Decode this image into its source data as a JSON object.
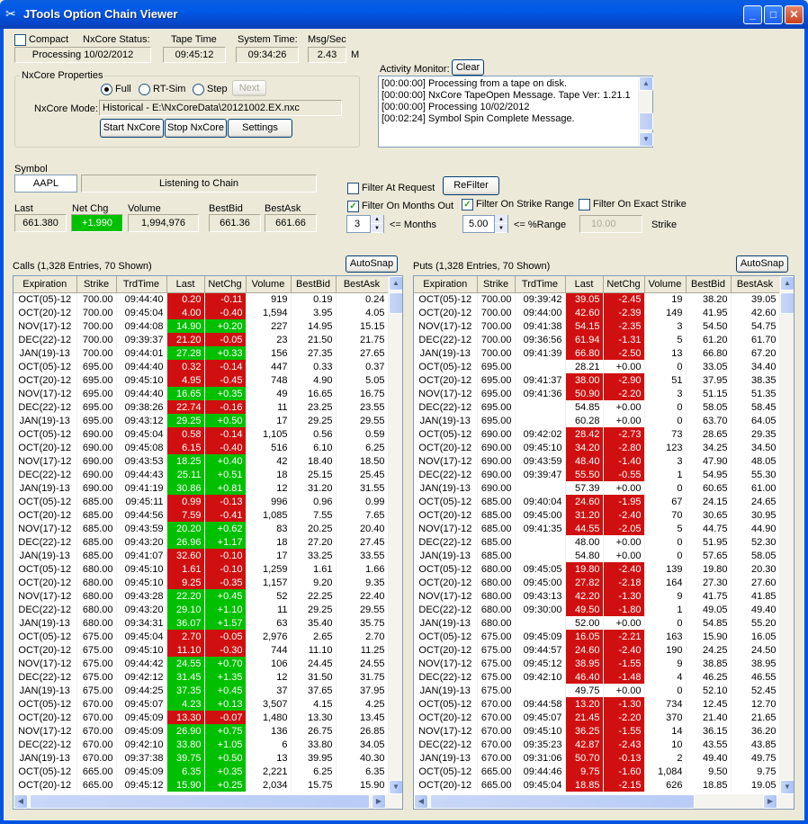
{
  "window": {
    "title": "JTools Option Chain Viewer"
  },
  "status": {
    "compact_label": "Compact",
    "nxcore_status_label": "NxCore Status:",
    "nxcore_status_value": "Processing 10/02/2012",
    "tape_time_label": "Tape Time",
    "tape_time_value": "09:45:12",
    "system_time_label": "System Time:",
    "system_time_value": "09:34:26",
    "msg_sec_label": "Msg/Sec",
    "msg_sec_value": "2.43",
    "msg_sec_unit": "M"
  },
  "props": {
    "group_label": "NxCore Properties",
    "mode_full": "Full",
    "mode_rtsim": "RT-Sim",
    "mode_step": "Step",
    "next_label": "Next",
    "mode_label": "NxCore Mode:",
    "mode_value": "Historical - E:\\NxCoreData\\20121002.EX.nxc",
    "start_label": "Start NxCore",
    "stop_label": "Stop NxCore",
    "settings_label": "Settings"
  },
  "activity": {
    "label": "Activity Monitor:",
    "clear_label": "Clear",
    "lines": [
      "[00:00:00] Processing from a tape on disk.",
      "[00:00:00] NxCore TapeOpen Message. Tape Ver: 1.21.1",
      "[00:00:00] Processing 10/02/2012",
      "[00:02:24] Symbol Spin Complete Message."
    ]
  },
  "symbol": {
    "label": "Symbol",
    "value": "AAPL",
    "status": "Listening to Chain",
    "last_label": "Last",
    "last_value": "661.380",
    "netchg_label": "Net Chg",
    "netchg_value": "+1.990",
    "volume_label": "Volume",
    "volume_value": "1,994,976",
    "bestbid_label": "BestBid",
    "bestbid_value": "661.36",
    "bestask_label": "BestAsk",
    "bestask_value": "661.66"
  },
  "filters": {
    "at_request_label": "Filter At Request",
    "refilter_label": "ReFilter",
    "months_out_label": "Filter On Months Out",
    "months_value": "3",
    "months_suffix": "<= Months",
    "strike_range_label": "Filter On Strike Range",
    "range_value": "5.00",
    "range_suffix": "<= %Range",
    "exact_strike_label": "Filter On Exact Strike",
    "exact_value": "10.00",
    "strike_suffix": "Strike"
  },
  "calls": {
    "title": "Calls (1,328 Entries, 70 Shown)",
    "autosnap_label": "AutoSnap",
    "columns": [
      "Expiration",
      "Strike",
      "TrdTime",
      "Last",
      "NetChg",
      "Volume",
      "BestBid",
      "BestAsk"
    ],
    "rows": [
      [
        "OCT(05)-12",
        "700.00",
        "09:44:40",
        "0.20",
        "-0.11",
        "919",
        "0.19",
        "0.24"
      ],
      [
        "OCT(20)-12",
        "700.00",
        "09:45:04",
        "4.00",
        "-0.40",
        "1,594",
        "3.95",
        "4.05"
      ],
      [
        "NOV(17)-12",
        "700.00",
        "09:44:08",
        "14.90",
        "+0.20",
        "227",
        "14.95",
        "15.15"
      ],
      [
        "DEC(22)-12",
        "700.00",
        "09:39:37",
        "21.20",
        "-0.05",
        "23",
        "21.50",
        "21.75"
      ],
      [
        "JAN(19)-13",
        "700.00",
        "09:44:01",
        "27.28",
        "+0.33",
        "156",
        "27.35",
        "27.65"
      ],
      [
        "OCT(05)-12",
        "695.00",
        "09:44:40",
        "0.32",
        "-0.14",
        "447",
        "0.33",
        "0.37"
      ],
      [
        "OCT(20)-12",
        "695.00",
        "09:45:10",
        "4.95",
        "-0.45",
        "748",
        "4.90",
        "5.05"
      ],
      [
        "NOV(17)-12",
        "695.00",
        "09:44:40",
        "16.65",
        "+0.35",
        "49",
        "16.65",
        "16.75"
      ],
      [
        "DEC(22)-12",
        "695.00",
        "09:38:26",
        "22.74",
        "-0.16",
        "11",
        "23.25",
        "23.55"
      ],
      [
        "JAN(19)-13",
        "695.00",
        "09:43:12",
        "29.25",
        "+0.50",
        "17",
        "29.25",
        "29.55"
      ],
      [
        "OCT(05)-12",
        "690.00",
        "09:45:04",
        "0.58",
        "-0.14",
        "1,105",
        "0.56",
        "0.59"
      ],
      [
        "OCT(20)-12",
        "690.00",
        "09:45:08",
        "6.15",
        "-0.40",
        "516",
        "6.10",
        "6.25"
      ],
      [
        "NOV(17)-12",
        "690.00",
        "09:43:53",
        "18.25",
        "+0.40",
        "42",
        "18.40",
        "18.50"
      ],
      [
        "DEC(22)-12",
        "690.00",
        "09:44:43",
        "25.11",
        "+0.51",
        "18",
        "25.15",
        "25.45"
      ],
      [
        "JAN(19)-13",
        "690.00",
        "09:41:19",
        "30.86",
        "+0.81",
        "12",
        "31.20",
        "31.55"
      ],
      [
        "OCT(05)-12",
        "685.00",
        "09:45:11",
        "0.99",
        "-0.13",
        "996",
        "0.96",
        "0.99"
      ],
      [
        "OCT(20)-12",
        "685.00",
        "09:44:56",
        "7.59",
        "-0.41",
        "1,085",
        "7.55",
        "7.65"
      ],
      [
        "NOV(17)-12",
        "685.00",
        "09:43:59",
        "20.20",
        "+0.62",
        "83",
        "20.25",
        "20.40"
      ],
      [
        "DEC(22)-12",
        "685.00",
        "09:43:20",
        "26.96",
        "+1.17",
        "18",
        "27.20",
        "27.45"
      ],
      [
        "JAN(19)-13",
        "685.00",
        "09:41:07",
        "32.60",
        "-0.10",
        "17",
        "33.25",
        "33.55"
      ],
      [
        "OCT(05)-12",
        "680.00",
        "09:45:10",
        "1.61",
        "-0.10",
        "1,259",
        "1.61",
        "1.66"
      ],
      [
        "OCT(20)-12",
        "680.00",
        "09:45:10",
        "9.25",
        "-0.35",
        "1,157",
        "9.20",
        "9.35"
      ],
      [
        "NOV(17)-12",
        "680.00",
        "09:43:28",
        "22.20",
        "+0.45",
        "52",
        "22.25",
        "22.40"
      ],
      [
        "DEC(22)-12",
        "680.00",
        "09:43:20",
        "29.10",
        "+1.10",
        "11",
        "29.25",
        "29.55"
      ],
      [
        "JAN(19)-13",
        "680.00",
        "09:34:31",
        "36.07",
        "+1.57",
        "63",
        "35.40",
        "35.75"
      ],
      [
        "OCT(05)-12",
        "675.00",
        "09:45:04",
        "2.70",
        "-0.05",
        "2,976",
        "2.65",
        "2.70"
      ],
      [
        "OCT(20)-12",
        "675.00",
        "09:45:10",
        "11.10",
        "-0.30",
        "744",
        "11.10",
        "11.25"
      ],
      [
        "NOV(17)-12",
        "675.00",
        "09:44:42",
        "24.55",
        "+0.70",
        "106",
        "24.45",
        "24.55"
      ],
      [
        "DEC(22)-12",
        "675.00",
        "09:42:12",
        "31.45",
        "+1.35",
        "12",
        "31.50",
        "31.75"
      ],
      [
        "JAN(19)-13",
        "675.00",
        "09:44:25",
        "37.35",
        "+0.45",
        "37",
        "37.65",
        "37.95"
      ],
      [
        "OCT(05)-12",
        "670.00",
        "09:45:07",
        "4.23",
        "+0.13",
        "3,507",
        "4.15",
        "4.25"
      ],
      [
        "OCT(20)-12",
        "670.00",
        "09:45:09",
        "13.30",
        "-0.07",
        "1,480",
        "13.30",
        "13.45"
      ],
      [
        "NOV(17)-12",
        "670.00",
        "09:45:09",
        "26.90",
        "+0.75",
        "136",
        "26.75",
        "26.85"
      ],
      [
        "DEC(22)-12",
        "670.00",
        "09:42:10",
        "33.80",
        "+1.05",
        "6",
        "33.80",
        "34.05"
      ],
      [
        "JAN(19)-13",
        "670.00",
        "09:37:38",
        "39.75",
        "+0.50",
        "13",
        "39.95",
        "40.30"
      ],
      [
        "OCT(05)-12",
        "665.00",
        "09:45:09",
        "6.35",
        "+0.35",
        "2,221",
        "6.25",
        "6.35"
      ],
      [
        "OCT(20)-12",
        "665.00",
        "09:45:12",
        "15.90",
        "+0.25",
        "2,034",
        "15.75",
        "15.90"
      ]
    ]
  },
  "puts": {
    "title": "Puts (1,328 Entries, 70 Shown)",
    "autosnap_label": "AutoSnap",
    "columns": [
      "Expiration",
      "Strike",
      "TrdTime",
      "Last",
      "NetChg",
      "Volume",
      "BestBid",
      "BestAsk"
    ],
    "rows": [
      [
        "OCT(05)-12",
        "700.00",
        "09:39:42",
        "39.05",
        "-2.45",
        "19",
        "38.20",
        "39.05"
      ],
      [
        "OCT(20)-12",
        "700.00",
        "09:44:00",
        "42.60",
        "-2.39",
        "149",
        "41.95",
        "42.60"
      ],
      [
        "NOV(17)-12",
        "700.00",
        "09:41:38",
        "54.15",
        "-2.35",
        "3",
        "54.50",
        "54.75"
      ],
      [
        "DEC(22)-12",
        "700.00",
        "09:36:56",
        "61.94",
        "-1.31",
        "5",
        "61.20",
        "61.70"
      ],
      [
        "JAN(19)-13",
        "700.00",
        "09:41:39",
        "66.80",
        "-2.50",
        "13",
        "66.80",
        "67.20"
      ],
      [
        "OCT(05)-12",
        "695.00",
        "",
        "28.21",
        "+0.00",
        "0",
        "33.05",
        "34.40"
      ],
      [
        "OCT(20)-12",
        "695.00",
        "09:41:37",
        "38.00",
        "-2.90",
        "51",
        "37.95",
        "38.35"
      ],
      [
        "NOV(17)-12",
        "695.00",
        "09:41:36",
        "50.90",
        "-2.20",
        "3",
        "51.15",
        "51.35"
      ],
      [
        "DEC(22)-12",
        "695.00",
        "",
        "54.85",
        "+0.00",
        "0",
        "58.05",
        "58.45"
      ],
      [
        "JAN(19)-13",
        "695.00",
        "",
        "60.28",
        "+0.00",
        "0",
        "63.70",
        "64.05"
      ],
      [
        "OCT(05)-12",
        "690.00",
        "09:42:02",
        "28.42",
        "-2.73",
        "73",
        "28.65",
        "29.35"
      ],
      [
        "OCT(20)-12",
        "690.00",
        "09:45:10",
        "34.20",
        "-2.80",
        "123",
        "34.25",
        "34.50"
      ],
      [
        "NOV(17)-12",
        "690.00",
        "09:43:59",
        "48.40",
        "-1.40",
        "3",
        "47.90",
        "48.05"
      ],
      [
        "DEC(22)-12",
        "690.00",
        "09:39:47",
        "55.50",
        "-0.55",
        "1",
        "54.95",
        "55.30"
      ],
      [
        "JAN(19)-13",
        "690.00",
        "",
        "57.39",
        "+0.00",
        "0",
        "60.65",
        "61.00"
      ],
      [
        "OCT(05)-12",
        "685.00",
        "09:40:04",
        "24.60",
        "-1.95",
        "67",
        "24.15",
        "24.65"
      ],
      [
        "OCT(20)-12",
        "685.00",
        "09:45:00",
        "31.20",
        "-2.40",
        "70",
        "30.65",
        "30.95"
      ],
      [
        "NOV(17)-12",
        "685.00",
        "09:41:35",
        "44.55",
        "-2.05",
        "5",
        "44.75",
        "44.90"
      ],
      [
        "DEC(22)-12",
        "685.00",
        "",
        "48.00",
        "+0.00",
        "0",
        "51.95",
        "52.30"
      ],
      [
        "JAN(19)-13",
        "685.00",
        "",
        "54.80",
        "+0.00",
        "0",
        "57.65",
        "58.05"
      ],
      [
        "OCT(05)-12",
        "680.00",
        "09:45:05",
        "19.80",
        "-2.40",
        "139",
        "19.80",
        "20.30"
      ],
      [
        "OCT(20)-12",
        "680.00",
        "09:45:00",
        "27.82",
        "-2.18",
        "164",
        "27.30",
        "27.60"
      ],
      [
        "NOV(17)-12",
        "680.00",
        "09:43:13",
        "42.20",
        "-1.30",
        "9",
        "41.75",
        "41.85"
      ],
      [
        "DEC(22)-12",
        "680.00",
        "09:30:00",
        "49.50",
        "-1.80",
        "1",
        "49.05",
        "49.40"
      ],
      [
        "JAN(19)-13",
        "680.00",
        "",
        "52.00",
        "+0.00",
        "0",
        "54.85",
        "55.20"
      ],
      [
        "OCT(05)-12",
        "675.00",
        "09:45:09",
        "16.05",
        "-2.21",
        "163",
        "15.90",
        "16.05"
      ],
      [
        "OCT(20)-12",
        "675.00",
        "09:44:57",
        "24.60",
        "-2.40",
        "190",
        "24.25",
        "24.50"
      ],
      [
        "NOV(17)-12",
        "675.00",
        "09:45:12",
        "38.95",
        "-1.55",
        "9",
        "38.85",
        "38.95"
      ],
      [
        "DEC(22)-12",
        "675.00",
        "09:42:10",
        "46.40",
        "-1.48",
        "4",
        "46.25",
        "46.55"
      ],
      [
        "JAN(19)-13",
        "675.00",
        "",
        "49.75",
        "+0.00",
        "0",
        "52.10",
        "52.45"
      ],
      [
        "OCT(05)-12",
        "670.00",
        "09:44:58",
        "13.20",
        "-1.30",
        "734",
        "12.45",
        "12.70"
      ],
      [
        "OCT(20)-12",
        "670.00",
        "09:45:07",
        "21.45",
        "-2.20",
        "370",
        "21.40",
        "21.65"
      ],
      [
        "NOV(17)-12",
        "670.00",
        "09:45:10",
        "36.25",
        "-1.55",
        "14",
        "36.15",
        "36.20"
      ],
      [
        "DEC(22)-12",
        "670.00",
        "09:35:23",
        "42.87",
        "-2.43",
        "10",
        "43.55",
        "43.85"
      ],
      [
        "JAN(19)-13",
        "670.00",
        "09:31:06",
        "50.70",
        "-0.13",
        "2",
        "49.40",
        "49.75"
      ],
      [
        "OCT(05)-12",
        "665.00",
        "09:44:46",
        "9.75",
        "-1.60",
        "1,084",
        "9.50",
        "9.75"
      ],
      [
        "OCT(20)-12",
        "665.00",
        "09:45:04",
        "18.85",
        "-2.15",
        "626",
        "18.85",
        "19.05"
      ]
    ]
  },
  "colors": {
    "positive": "#00c000",
    "negative": "#d01010",
    "titlebar": "#0058e6"
  }
}
